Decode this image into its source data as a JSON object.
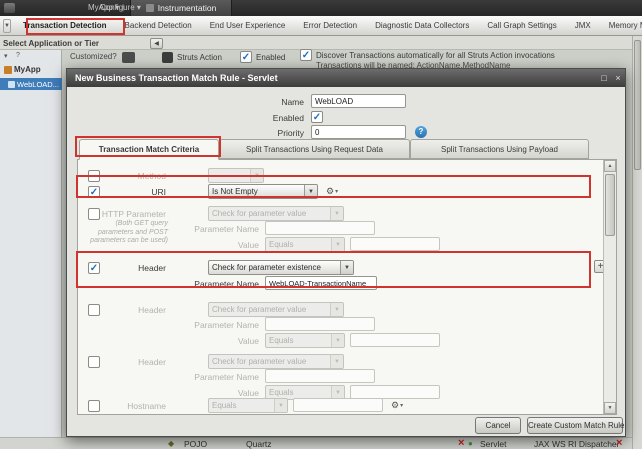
{
  "topbar": {
    "breadcrumb_app": "MyApp",
    "breadcrumb_section": "Configure",
    "active_tab": "Instrumentation"
  },
  "tabstrip": {
    "tabs": [
      "Transaction Detection",
      "Backend Detection",
      "End User Experience",
      "Error Detection",
      "Diagnostic Data Collectors",
      "Call Graph Settings",
      "JMX",
      "Memory Monitoring"
    ]
  },
  "app_selector": {
    "label": "Select Application or Tier"
  },
  "tree": {
    "root_label": "MyApp",
    "selected_node": "WebLOAD..."
  },
  "detection_panel": {
    "customized_label": "Customized?",
    "entry_point": "Struts Action",
    "enabled_label": "Enabled",
    "discover_label": "Discover Transactions automatically for all Struts Action invocations",
    "naming_label": "Transactions will be named: ActionName.MethodName"
  },
  "dialog": {
    "title": "New Business Transaction Match Rule - Servlet",
    "name_label": "Name",
    "name_value": "WebLOAD",
    "enabled_label": "Enabled",
    "priority_label": "Priority",
    "priority_value": "0",
    "tabs": [
      "Transaction Match Criteria",
      "Split Transactions Using Request Data",
      "Split Transactions Using Payload"
    ],
    "criteria": {
      "method": {
        "label": "Method"
      },
      "uri": {
        "label": "URI",
        "operator": "Is Not Empty"
      },
      "http_param": {
        "label": "HTTP Parameter",
        "note": "(Both GET query parameters and POST parameters can be used)",
        "mode": "Check for parameter value",
        "param_label": "Parameter Name",
        "value_label": "Value",
        "value_operator": "Equals"
      },
      "header1": {
        "label": "Header",
        "mode": "Check for parameter existence",
        "param_label": "Parameter Name",
        "param_value": "WebLOAD-TransactionName"
      },
      "header2": {
        "label": "Header",
        "mode": "Check for parameter value",
        "param_label": "Parameter Name",
        "value_label": "Value",
        "value_operator": "Equals"
      },
      "header3": {
        "label": "Header",
        "mode": "Check for parameter value",
        "param_label": "Parameter Name",
        "value_label": "Value",
        "value_operator": "Equals"
      },
      "hostname": {
        "label": "Hostname",
        "operator": "Equals"
      }
    },
    "cancel_button": "Cancel",
    "create_button": "Create Custom Match Rule"
  },
  "background_grid": {
    "row1_name": "POJO",
    "row1_type": "Quartz",
    "row2_name": "Servlet",
    "row2_type": "JAX WS RI Dispatcher"
  },
  "icons": {
    "chevron_down": "▾",
    "dropdown_arrow": "▼",
    "collapse_left": "◀",
    "gear": "⚙",
    "plus": "+",
    "help": "?",
    "check": "✓",
    "close": "×",
    "restore": "□",
    "scroll_up": "▲",
    "scroll_down": "▼",
    "red_x": "×",
    "diamond": "◆",
    "dot": "●"
  },
  "colors": {
    "annotation": "#d0342e",
    "accent_blue": "#2a72b0",
    "selection_blue": "#3f7cba"
  }
}
